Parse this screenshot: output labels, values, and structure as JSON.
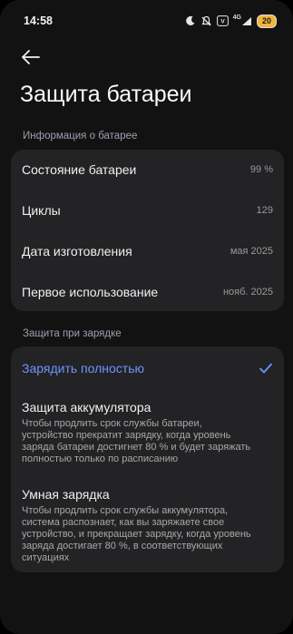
{
  "status_bar": {
    "time": "14:58",
    "network_label": "4G",
    "battery_level": "20",
    "icons": [
      "moon-icon",
      "mute-icon",
      "volte-icon",
      "signal-icon",
      "battery-icon"
    ]
  },
  "header": {
    "title": "Защита батареи",
    "back_icon": "back-arrow-icon"
  },
  "battery_info": {
    "section_label": "Информация о батарее",
    "rows": [
      {
        "label": "Состояние батареи",
        "value": "99 %"
      },
      {
        "label": "Циклы",
        "value": "129"
      },
      {
        "label": "Дата изготовления",
        "value": "мая 2025"
      },
      {
        "label": "Первое использование",
        "value": "нояб. 2025"
      }
    ]
  },
  "charging_protection": {
    "section_label": "Защита при зарядке",
    "options": [
      {
        "title": "Зарядить полностью",
        "description": "",
        "selected": true
      },
      {
        "title": "Защита аккумулятора",
        "description": "Чтобы продлить срок службы батареи, устройство прекратит зарядку, когда уровень заряда батареи достигнет 80 % и будет заряжать полностью только по расписанию",
        "selected": false
      },
      {
        "title": "Умная зарядка",
        "description": "Чтобы продлить срок службы аккумулятора, система распознает, как вы заряжаете свое устройство, и прекращает зарядку, когда уровень заряда достигает 80 %, в соответствующих ситуациях",
        "selected": false
      }
    ]
  },
  "colors": {
    "accent": "#6f93ff",
    "background": "#121212",
    "card": "#232325",
    "battery_badge": "#f2b53a"
  }
}
